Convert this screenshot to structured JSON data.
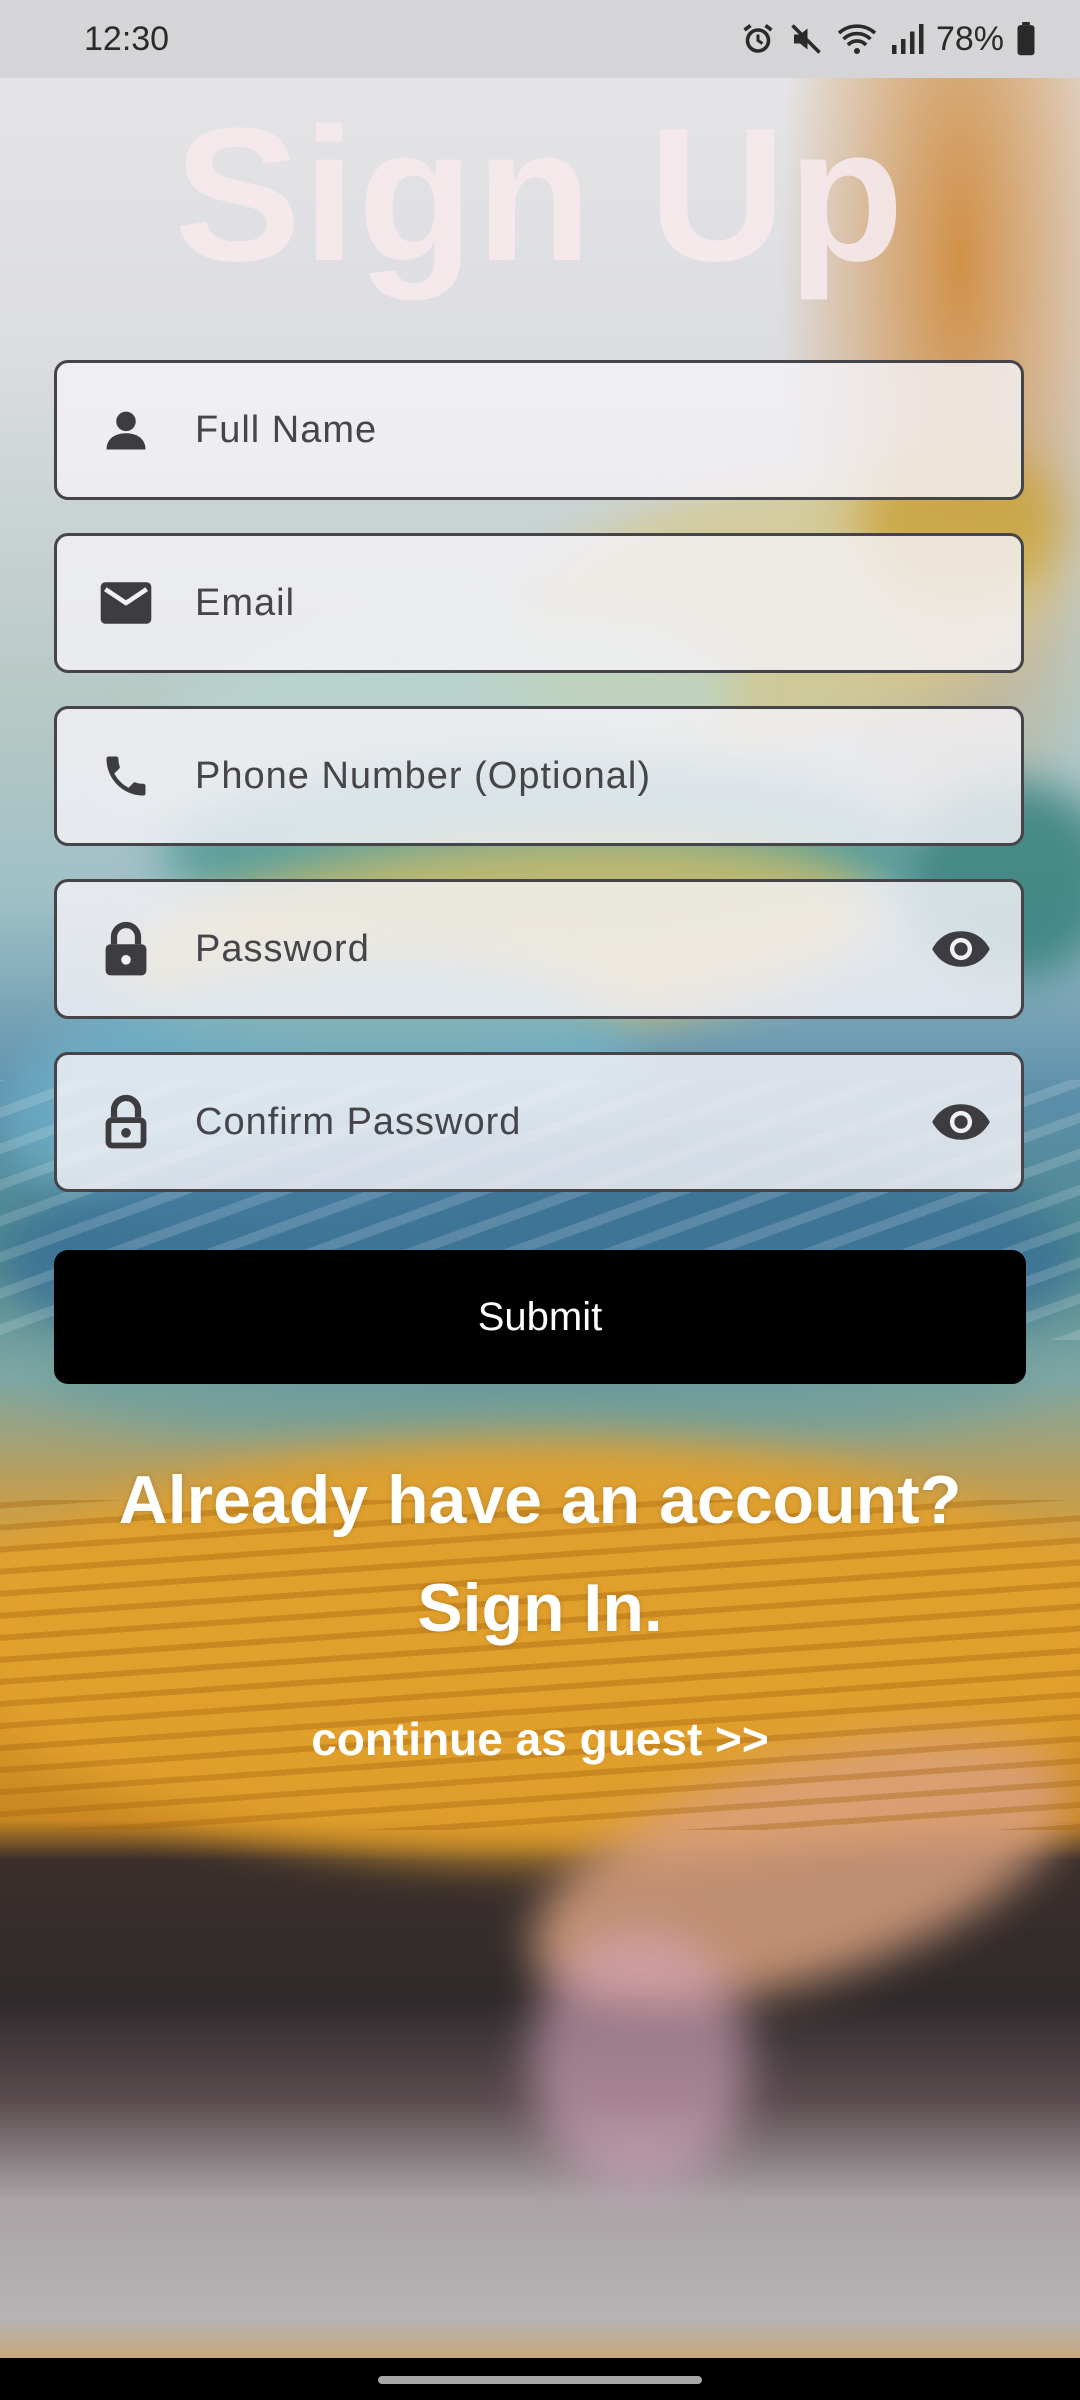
{
  "status_bar": {
    "time": "12:30",
    "battery": "78%",
    "icons": [
      "alarm-icon",
      "mute-icon",
      "wifi-icon",
      "signal-icon",
      "battery-icon"
    ]
  },
  "title": "Sign Up",
  "form": {
    "full_name": {
      "placeholder": "Full Name",
      "value": "",
      "icon": "person-icon"
    },
    "email": {
      "placeholder": "Email",
      "value": "",
      "icon": "mail-icon"
    },
    "phone": {
      "placeholder": "Phone Number (Optional)",
      "value": "",
      "icon": "phone-icon"
    },
    "password": {
      "placeholder": "Password",
      "value": "",
      "icon": "lock-icon",
      "toggle_icon": "eye-icon"
    },
    "confirm_password": {
      "placeholder": "Confirm Password",
      "value": "",
      "icon": "lock-outline-icon",
      "toggle_icon": "eye-icon"
    }
  },
  "submit_label": "Submit",
  "signin_prompt": "Already have an account?",
  "signin_link": "Sign In.",
  "guest_link": "continue as guest >>",
  "colors": {
    "button_bg": "#000000",
    "field_border": "#444449",
    "title": "#f5e8eb"
  }
}
